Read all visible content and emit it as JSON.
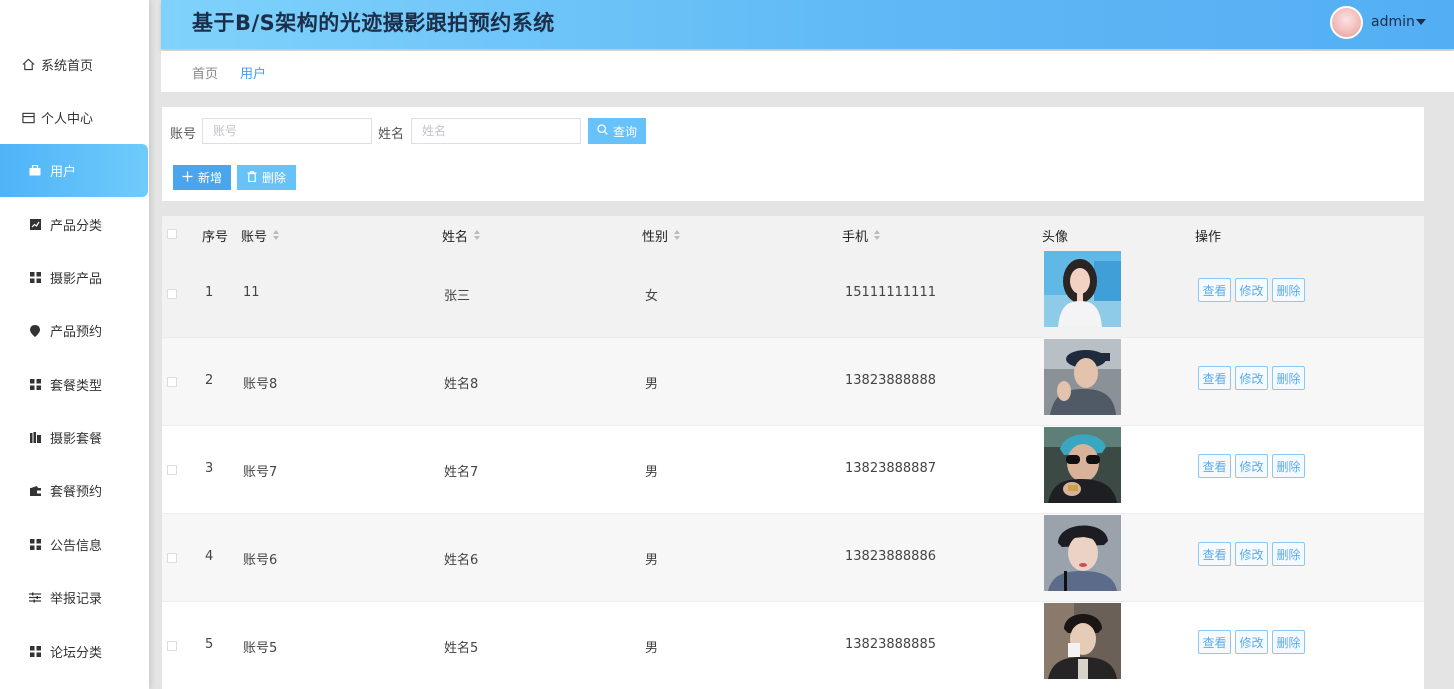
{
  "app": {
    "title": "基于B/S架构的光迹摄影跟拍预约系统",
    "user": "admin"
  },
  "sidebar": {
    "items": [
      {
        "label": "系统首页",
        "icon": "home-icon"
      },
      {
        "label": "个人中心",
        "icon": "card-icon"
      },
      {
        "label": "用户",
        "icon": "briefcase-icon",
        "active": true
      },
      {
        "label": "产品分类",
        "icon": "chart-icon"
      },
      {
        "label": "摄影产品",
        "icon": "grid-icon"
      },
      {
        "label": "产品预约",
        "icon": "pin-icon"
      },
      {
        "label": "套餐类型",
        "icon": "grid-icon"
      },
      {
        "label": "摄影套餐",
        "icon": "bars-icon"
      },
      {
        "label": "套餐预约",
        "icon": "wallet-icon"
      },
      {
        "label": "公告信息",
        "icon": "grid-icon"
      },
      {
        "label": "举报记录",
        "icon": "sliders-icon"
      },
      {
        "label": "论坛分类",
        "icon": "grid-icon"
      }
    ]
  },
  "breadcrumb": {
    "home": "首页",
    "current": "用户"
  },
  "search": {
    "account_label": "账号",
    "account_placeholder": "账号",
    "name_label": "姓名",
    "name_placeholder": "姓名",
    "query_label": "查询",
    "add_label": "新增",
    "delete_label": "删除"
  },
  "table": {
    "headers": {
      "index": "序号",
      "account": "账号",
      "name": "姓名",
      "gender": "性别",
      "phone": "手机",
      "avatar": "头像",
      "actions": "操作"
    },
    "rows": [
      {
        "index": "1",
        "account": "11",
        "name": "张三",
        "gender": "女",
        "phone": "15111111111"
      },
      {
        "index": "2",
        "account": "账号8",
        "name": "姓名8",
        "gender": "男",
        "phone": "13823888888"
      },
      {
        "index": "3",
        "account": "账号7",
        "name": "姓名7",
        "gender": "男",
        "phone": "13823888887"
      },
      {
        "index": "4",
        "account": "账号6",
        "name": "姓名6",
        "gender": "男",
        "phone": "13823888886"
      },
      {
        "index": "5",
        "account": "账号5",
        "name": "姓名5",
        "gender": "男",
        "phone": "13823888885"
      }
    ],
    "row_actions": {
      "view": "查看",
      "edit": "修改",
      "delete": "删除"
    }
  },
  "colors": {
    "accent": "#409eff",
    "header_start": "#7fd2fb",
    "header_end": "#54aef4",
    "sidebar_active": "#4fb3f7"
  }
}
